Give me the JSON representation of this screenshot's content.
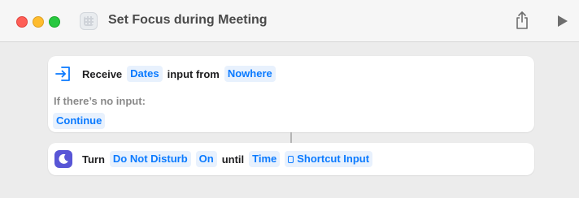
{
  "window": {
    "title": "Set Focus during Meeting",
    "icons": [
      "shortcut-app-icon",
      "share-icon",
      "play-icon"
    ]
  },
  "actions": [
    {
      "icon": "receive-input-icon",
      "parts": {
        "verb": "Receive",
        "input_type": "Dates",
        "connector": "input from",
        "source": "Nowhere"
      },
      "no_input_label": "If there’s no input:",
      "no_input_action": "Continue"
    },
    {
      "icon": "moon-icon",
      "accent": "#5856d6",
      "parts": {
        "verb": "Turn",
        "focus": "Do Not Disturb",
        "state": "On",
        "until_word": "until",
        "until_type": "Time",
        "variable": "Shortcut Input"
      }
    }
  ],
  "colors": {
    "token_text": "#0a7aff",
    "token_bg": "#e8f1fd",
    "window_bg": "#ececec"
  }
}
